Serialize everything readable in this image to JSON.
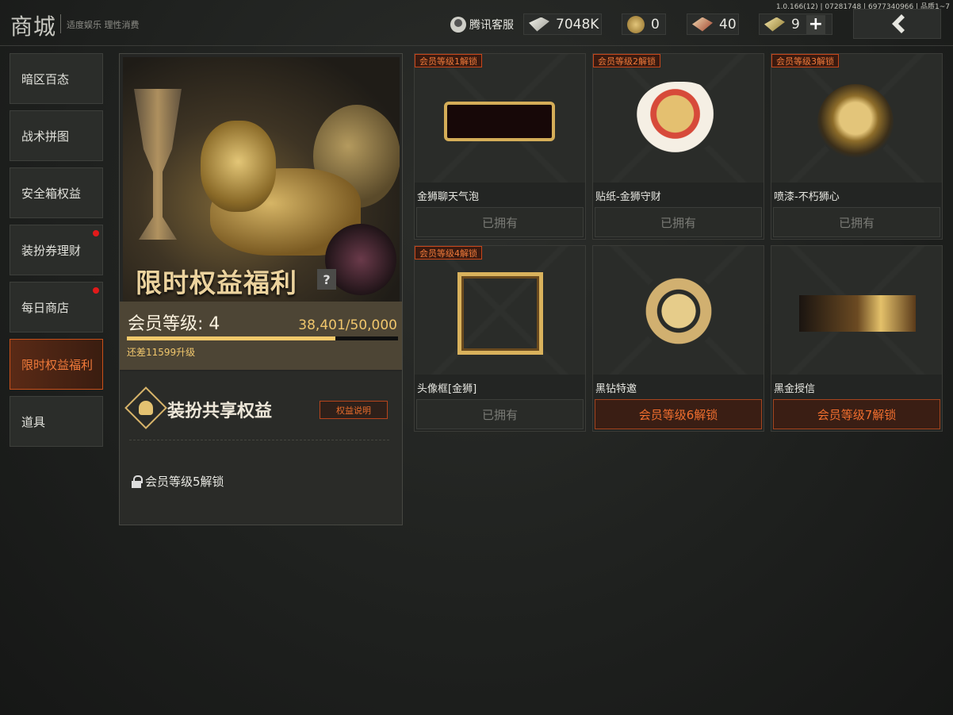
{
  "version": "1.0.166(12) | 07281748 | 6977340966 | 品质1~7",
  "header": {
    "title": "商城",
    "slogan": "适度娱乐 理性消费",
    "customer_service": "腾讯客服",
    "currencies": [
      {
        "icon": "ticket-icon",
        "value": "7048K"
      },
      {
        "icon": "coin-icon",
        "value": "0"
      },
      {
        "icon": "card-icon",
        "value": "40"
      },
      {
        "icon": "gold-bar-icon",
        "value": "9"
      }
    ],
    "add_label": "+"
  },
  "sidebar": {
    "items": [
      {
        "label": "暗区百态",
        "active": false,
        "dot": false
      },
      {
        "label": "战术拼图",
        "active": false,
        "dot": false
      },
      {
        "label": "安全箱权益",
        "active": false,
        "dot": false
      },
      {
        "label": "装扮券理财",
        "active": false,
        "dot": true
      },
      {
        "label": "每日商店",
        "active": false,
        "dot": true
      },
      {
        "label": "限时权益福利",
        "active": true,
        "dot": false
      },
      {
        "label": "道具",
        "active": false,
        "dot": false
      }
    ]
  },
  "hero": {
    "title": "限时权益福利",
    "help": "?",
    "level_label": "会员等级: 4",
    "progress_text": "38,401/50,000",
    "progress_fraction": 0.768,
    "hint": "还差11599升级"
  },
  "share": {
    "title": "装扮共享权益",
    "explain_button": "权益说明",
    "unlock_text": "会员等级5解锁"
  },
  "items": [
    {
      "tag": "会员等级1解锁",
      "name": "金狮聊天气泡",
      "button": "已拥有"
    },
    {
      "tag": "会员等级2解锁",
      "name": "贴纸-金狮守财",
      "button": "已拥有"
    },
    {
      "tag": "会员等级3解锁",
      "name": "喷漆-不朽狮心",
      "button": "已拥有"
    },
    {
      "tag": "会员等级4解锁",
      "name": "头像框[金狮]",
      "button": "已拥有"
    },
    {
      "tag": "",
      "name": "黑钻特邀",
      "button": "会员等级6解锁"
    },
    {
      "tag": "",
      "name": "黑金授信",
      "button": "会员等级7解锁"
    }
  ],
  "colors": {
    "accent": "#f07a3a",
    "gold": "#f0c66c",
    "alert_dot": "#e21a1a"
  }
}
